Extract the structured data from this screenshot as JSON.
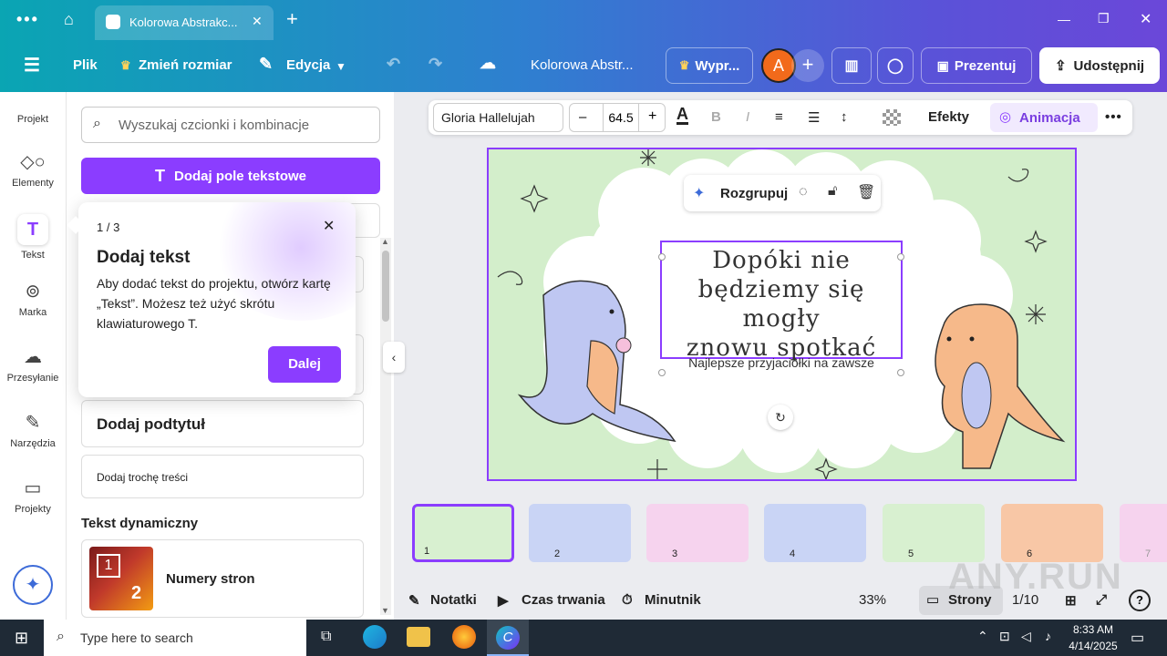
{
  "browser": {
    "tab_title": "Kolorowa Abstrakc...",
    "close": "✕",
    "new_tab": "+"
  },
  "toolbar": {
    "menu": "Plik",
    "resize": "Zmień rozmiar",
    "edit": "Edycja",
    "doc_title": "Kolorowa Abstr...",
    "upgrade": "Wypr...",
    "avatar": "A",
    "present": "Prezentuj",
    "share": "Udostępnij"
  },
  "rail": [
    {
      "label": "Projekt"
    },
    {
      "label": "Elementy"
    },
    {
      "label": "Tekst"
    },
    {
      "label": "Marka"
    },
    {
      "label": "Przesyłanie"
    },
    {
      "label": "Narzędzia"
    },
    {
      "label": "Projekty"
    }
  ],
  "panel": {
    "search_placeholder": "Wyszukaj czcionki i kombinacje",
    "add_textbox": "Dodaj pole tekstowe",
    "subtitle": "Dodaj podtytuł",
    "body": "Dodaj trochę treści",
    "dynamic_heading": "Tekst dynamiczny",
    "page_numbers": "Numery stron",
    "page_num_1": "1",
    "page_num_2": "2"
  },
  "tooltip": {
    "step": "1 / 3",
    "title": "Dodaj tekst",
    "body": "Aby dodać tekst do projektu, otwórz kartę „Tekst”. Możesz też użyć skrótu klawiaturowego T.",
    "next": "Dalej"
  },
  "format": {
    "font": "Gloria Hallelujah",
    "minus": "–",
    "size": "64.5",
    "plus": "+",
    "effects": "Efekty",
    "animation": "Animacja"
  },
  "context": {
    "ungroup": "Rozgrupuj"
  },
  "slide": {
    "title": "Dopóki nie\nbędziemy się mogły\nznowu spotkać",
    "subtitle": "Najlepsze przyjaciółki na zawsze"
  },
  "thumbs": [
    {
      "n": "1",
      "bg": "#d8f0d0"
    },
    {
      "n": "2",
      "bg": "#c9d4f5"
    },
    {
      "n": "3",
      "bg": "#f6d3ee"
    },
    {
      "n": "4",
      "bg": "#c9d4f5"
    },
    {
      "n": "5",
      "bg": "#d8f0d0"
    },
    {
      "n": "6",
      "bg": "#f8c7a6"
    },
    {
      "n": "7",
      "bg": "#f6d3ee"
    }
  ],
  "bottom": {
    "notes": "Notatki",
    "duration": "Czas trwania",
    "timer": "Minutnik",
    "zoom": "33%",
    "pages": "Strony",
    "page_count": "1/10",
    "help": "?"
  },
  "taskbar": {
    "search_placeholder": "Type here to search",
    "time": "8:33 AM",
    "date": "4/14/2025"
  },
  "watermark": "ANY.RUN",
  "colors": {
    "accent": "#8b3dff",
    "slide_bg": "#d3eecb"
  }
}
